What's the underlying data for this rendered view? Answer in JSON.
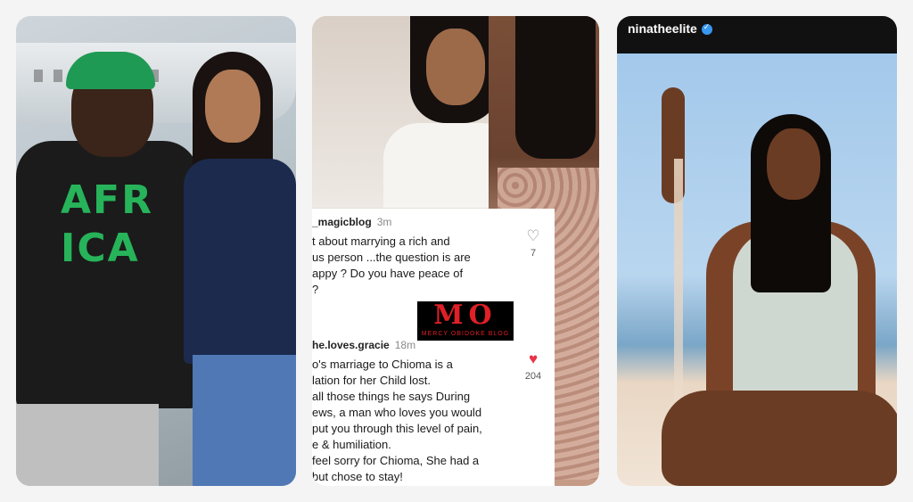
{
  "panel2": {
    "comment1": {
      "user": "_magicblog",
      "time": "3m",
      "lines": [
        "t about marrying a rich and",
        "us person ...the question is are",
        "appy ? Do you have peace of",
        "?"
      ],
      "likes": "7"
    },
    "comment2": {
      "user": "he.loves.gracie",
      "time": "18m",
      "lines": [
        "o's marriage to Chioma is a",
        "lation for her Child lost.",
        "all those things he says During",
        "ews, a man who loves you would",
        "put you through this level of pain,",
        "e & humiliation.",
        "feel sorry for Chioma, She had a",
        "but chose to stay!"
      ],
      "likes": "204"
    },
    "watermark": {
      "big": "MO",
      "small": "MERCY OBIDOKE BLOG"
    }
  },
  "panel1": {
    "shirt_text": "AFR ICA"
  },
  "panel3": {
    "username": "ninatheelite"
  },
  "colors": {
    "heart_filled": "#e8344a",
    "watermark_red": "#e01f26",
    "verified_blue": "#3897f0"
  }
}
